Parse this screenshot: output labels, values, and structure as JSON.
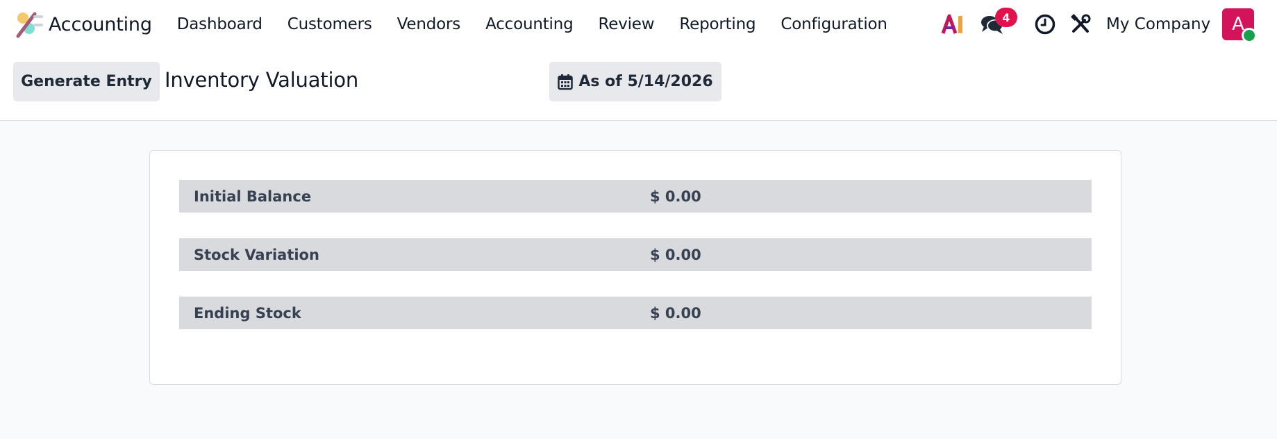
{
  "navbar": {
    "app_name": "Accounting",
    "menu": [
      {
        "label": "Dashboard"
      },
      {
        "label": "Customers"
      },
      {
        "label": "Vendors"
      },
      {
        "label": "Accounting"
      },
      {
        "label": "Review"
      },
      {
        "label": "Reporting"
      },
      {
        "label": "Configuration"
      }
    ],
    "systray": {
      "ai_icon": "ai-icon",
      "chat_icon": "chat-icon",
      "message_count": "4",
      "activity_icon": "clock-icon",
      "settings_icon": "tools-icon",
      "company": "My Company",
      "avatar_initial": "A",
      "avatar_color": "#d4145a",
      "presence_color": "#19a04b"
    }
  },
  "control_panel": {
    "generate_button": "Generate Entry",
    "title": "Inventory Valuation",
    "date_button": "As of 5/14/2026",
    "date_icon": "calendar-icon"
  },
  "valuation": {
    "rows": [
      {
        "label": "Initial Balance",
        "value": "$ 0.00"
      },
      {
        "label": "Stock Variation",
        "value": "$ 0.00"
      },
      {
        "label": "Ending Stock",
        "value": "$ 0.00"
      }
    ]
  }
}
